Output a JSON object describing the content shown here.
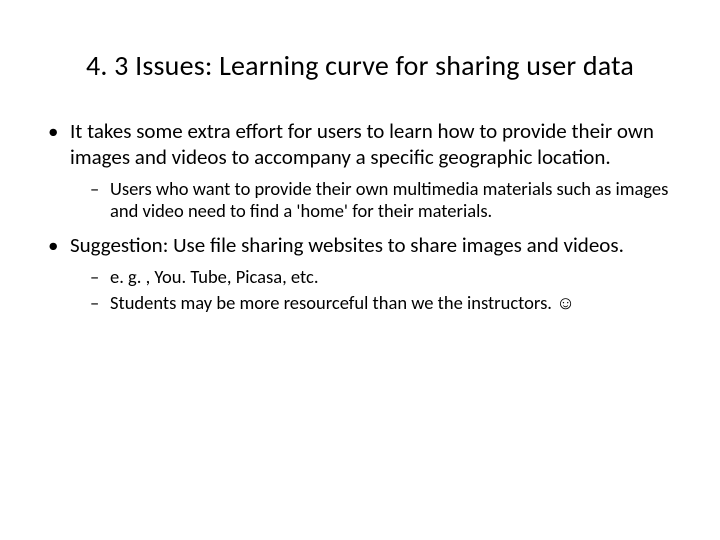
{
  "title": "4. 3 Issues: Learning curve for sharing user data",
  "bullets": [
    {
      "text": "It takes some extra effort for users to learn how to provide their own images and videos to accompany a specific geographic location.",
      "sub": [
        "Users who want to provide their own multimedia materials such as images and video need to find a 'home' for their materials."
      ]
    },
    {
      "text": "Suggestion: Use file sharing websites to share images and videos.",
      "sub": [
        "e. g. ,  You. Tube, Picasa, etc.",
        "Students may be more resourceful than we the instructors. ☺"
      ]
    }
  ]
}
